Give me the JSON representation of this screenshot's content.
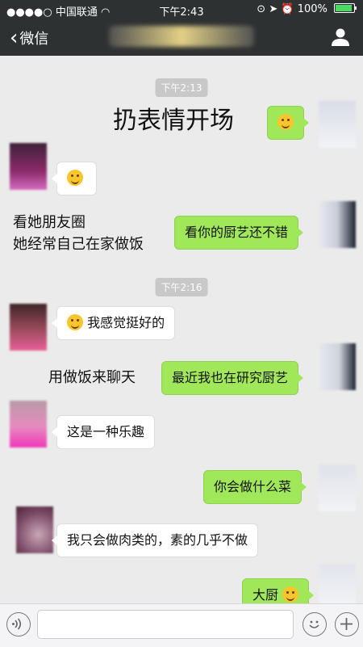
{
  "status": {
    "carrier": "中国联通",
    "time": "下午2:43",
    "battery": "100%"
  },
  "nav": {
    "back_label": "微信"
  },
  "timestamps": [
    "下午2:13",
    "下午2:16"
  ],
  "captions": [
    "扔表情开场",
    "看她朋友圈",
    "她经常自己在家做饭",
    "用做饭来聊天"
  ],
  "messages": [
    {
      "side": "right",
      "text": ""
    },
    {
      "side": "left",
      "text": ""
    },
    {
      "side": "right",
      "text": "看你的厨艺还不错"
    },
    {
      "side": "left",
      "text": "我感觉挺好的"
    },
    {
      "side": "right",
      "text": "最近我也在研究厨艺"
    },
    {
      "side": "left",
      "text": "这是一种乐趣"
    },
    {
      "side": "right",
      "text": "你会做什么菜"
    },
    {
      "side": "left",
      "text": "我只会做肉类的，素的几乎不做"
    },
    {
      "side": "right",
      "text": "大厨"
    }
  ],
  "icons": [
    "back-chevron-icon",
    "profile-icon",
    "voice-icon",
    "emoji-icon",
    "plus-icon",
    "wifi-icon",
    "battery-icon"
  ],
  "colors": {
    "bar": "#2e3132",
    "green_bubble": "#a0e75a",
    "background": "#ebebeb"
  }
}
